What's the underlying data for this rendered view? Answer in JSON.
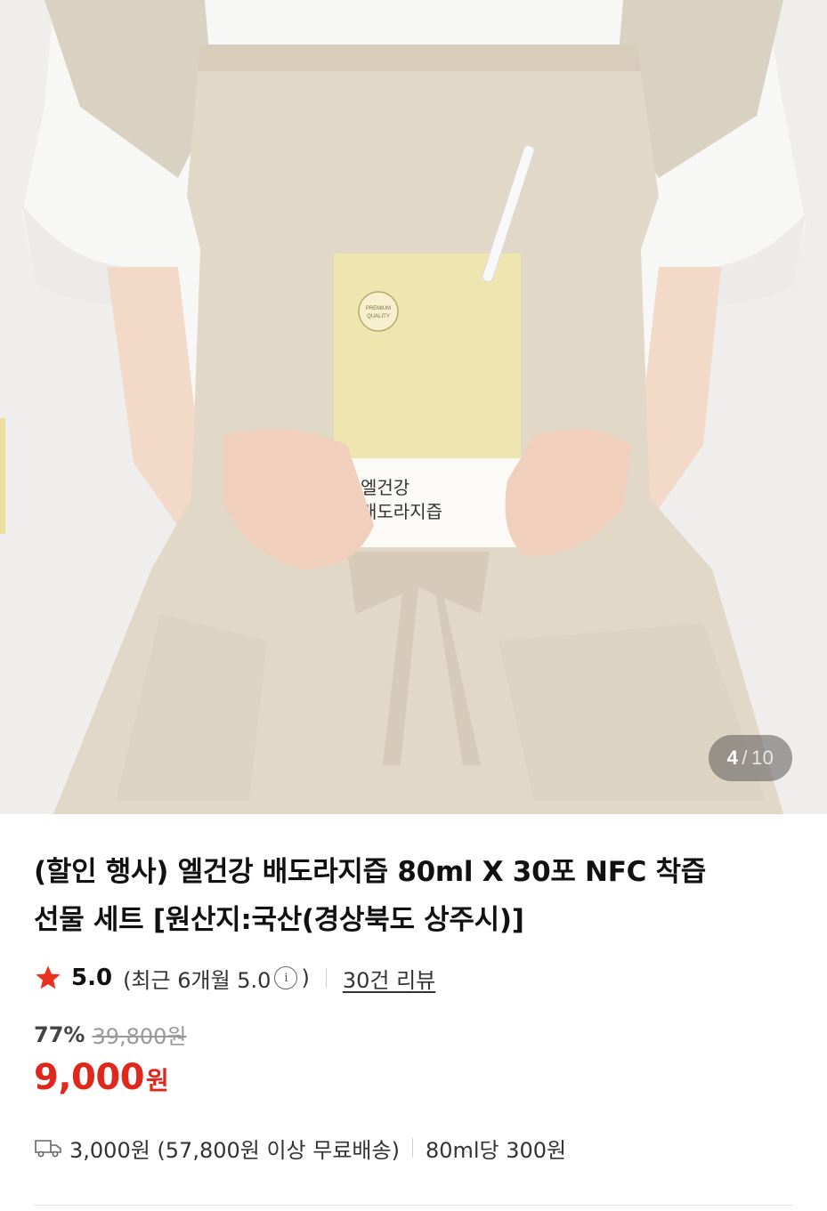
{
  "gallery": {
    "current": "4",
    "separator": "/",
    "total": "10",
    "pouch_brand": "엘건강",
    "pouch_product": "배도라지즙",
    "pouch_badge": "PREMIUM QUALITY"
  },
  "product": {
    "title_line1": "(할인 행사) 엘건강 배도라지즙 80ml X 30포 NFC 착즙",
    "title_line2": "선물 세트 [원산지:국산(경상북도 상주시)]"
  },
  "rating": {
    "score": "5.0",
    "recent_prefix": "(최근 6개월 5.0",
    "info_glyph": "i",
    "recent_suffix": ")",
    "reviews": "30건 리뷰",
    "star_color": "#e8321f"
  },
  "pricing": {
    "discount": "77%",
    "original_price": "39,800원",
    "price": "9,000",
    "currency": "원",
    "price_color": "#e0271c"
  },
  "shipping": {
    "fee": "3,000원 (57,800원 이상 무료배송)",
    "unit_price": "80ml당 300원"
  }
}
